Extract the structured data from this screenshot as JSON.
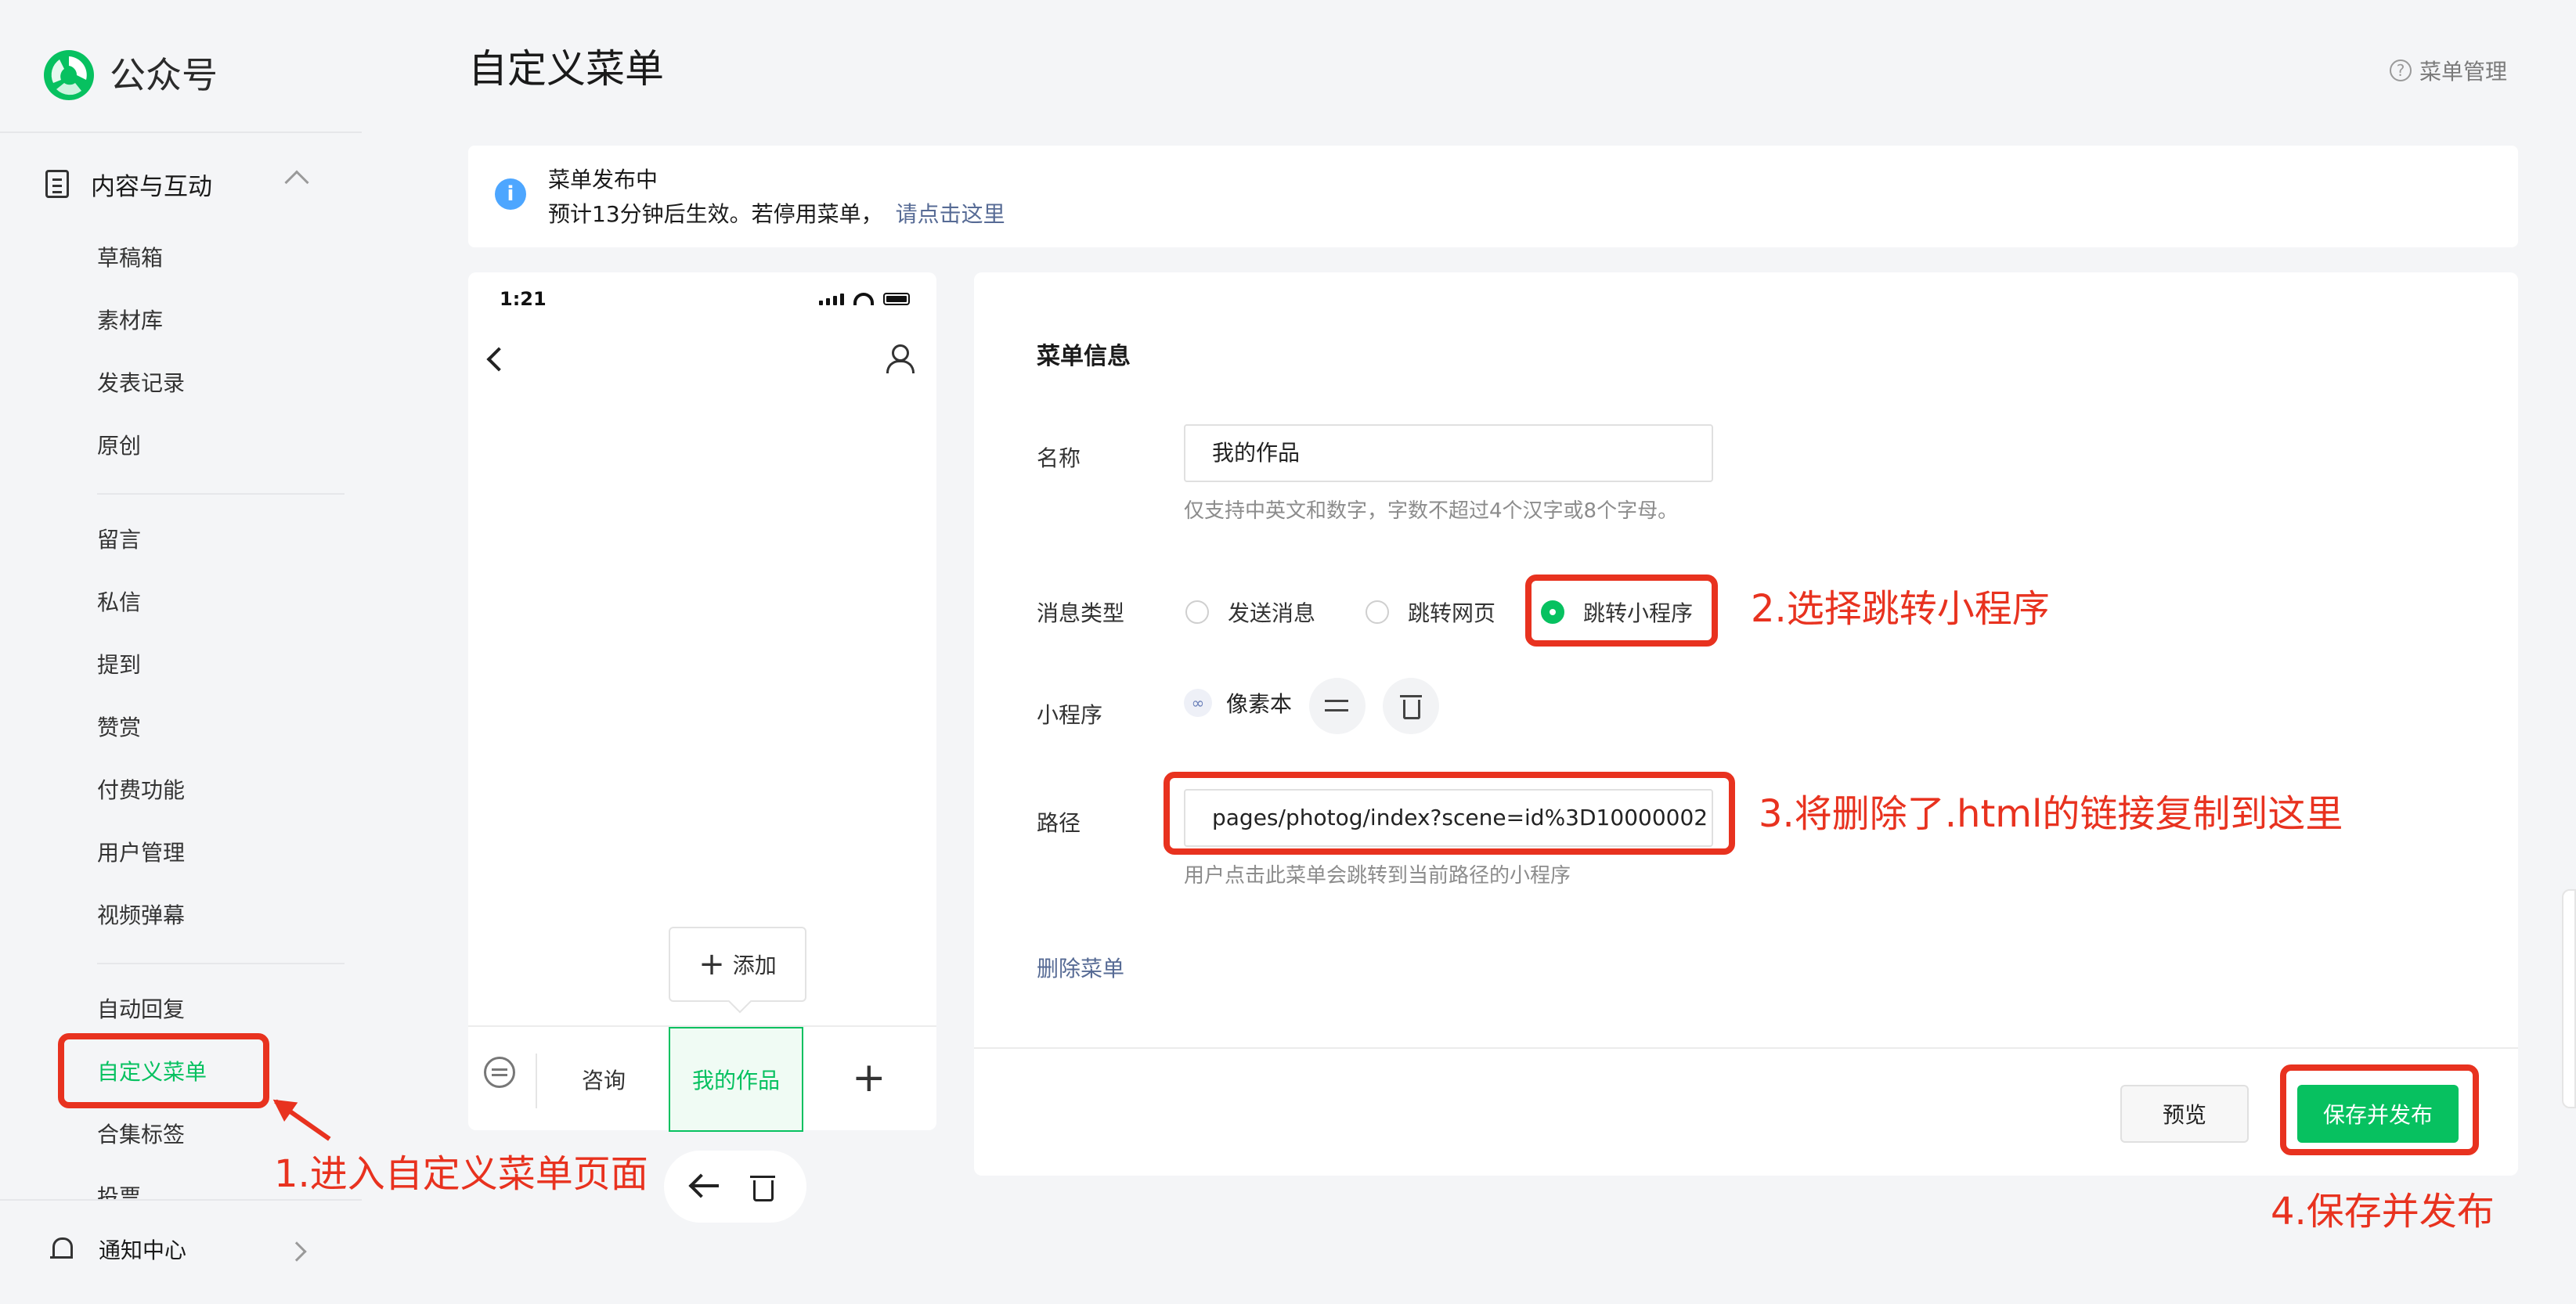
{
  "brand": {
    "name": "公众号",
    "accent": "#07c160"
  },
  "sidebar": {
    "group_label": "内容与互动",
    "items": [
      {
        "label": "草稿箱"
      },
      {
        "label": "素材库"
      },
      {
        "label": "发表记录"
      },
      {
        "label": "原创"
      },
      {
        "label": "留言"
      },
      {
        "label": "私信"
      },
      {
        "label": "提到"
      },
      {
        "label": "赞赏"
      },
      {
        "label": "付费功能"
      },
      {
        "label": "用户管理"
      },
      {
        "label": "视频弹幕"
      },
      {
        "label": "自动回复"
      },
      {
        "label": "自定义菜单"
      },
      {
        "label": "合集标签"
      },
      {
        "label": "投票"
      }
    ],
    "active_item": "自定义菜单",
    "notify_label": "通知中心"
  },
  "header": {
    "title": "自定义菜单",
    "help_label": "菜单管理"
  },
  "notice": {
    "title": "菜单发布中",
    "body": "预计13分钟后生效。若停用菜单，",
    "link": "请点击这里"
  },
  "phone": {
    "time": "1:21",
    "add_label": "添加",
    "menu": [
      {
        "label": "咨询"
      },
      {
        "label": "我的作品"
      }
    ]
  },
  "form": {
    "section_title": "菜单信息",
    "name_label": "名称",
    "name_value": "我的作品",
    "name_hint": "仅支持中英文和数字，字数不超过4个汉字或8个字母。",
    "type_label": "消息类型",
    "type_options": [
      {
        "label": "发送消息",
        "selected": false
      },
      {
        "label": "跳转网页",
        "selected": false
      },
      {
        "label": "跳转小程序",
        "selected": true
      }
    ],
    "miniprogram_label": "小程序",
    "miniprogram_name": "像素本",
    "path_label": "路径",
    "path_value": "pages/photog/index?scene=id%3D10000002",
    "path_hint": "用户点击此菜单会跳转到当前路径的小程序",
    "delete_label": "删除菜单",
    "preview_label": "预览",
    "save_label": "保存并发布"
  },
  "annotations": {
    "step1": "1.进入自定义菜单页面",
    "step2": "2.选择跳转小程序",
    "step3": "3.将删除了.html的链接复制到这里",
    "step4": "4.保存并发布",
    "color": "#e8321f"
  }
}
